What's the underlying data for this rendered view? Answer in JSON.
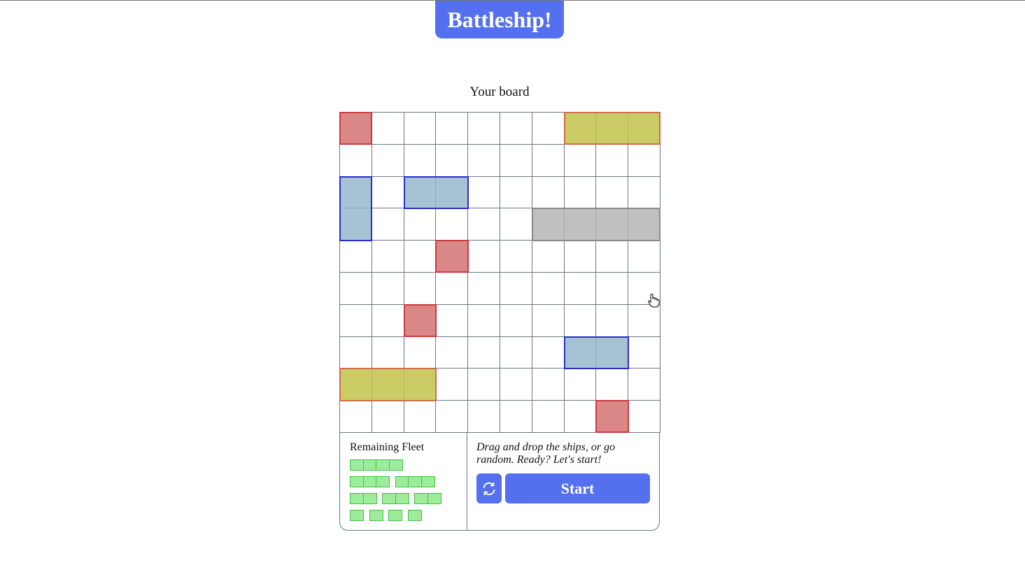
{
  "app": {
    "title": "Battleship!"
  },
  "board": {
    "label": "Your board",
    "rows": 10,
    "cols": 10,
    "ships": [
      {
        "color": "red",
        "row": 0,
        "col": 0,
        "length": 1,
        "orientation": "horizontal"
      },
      {
        "color": "yellow",
        "row": 0,
        "col": 7,
        "length": 3,
        "orientation": "horizontal"
      },
      {
        "color": "blue",
        "row": 2,
        "col": 0,
        "length": 2,
        "orientation": "vertical"
      },
      {
        "color": "blue",
        "row": 2,
        "col": 2,
        "length": 2,
        "orientation": "horizontal"
      },
      {
        "color": "gray",
        "row": 3,
        "col": 6,
        "length": 4,
        "orientation": "horizontal"
      },
      {
        "color": "red",
        "row": 4,
        "col": 3,
        "length": 1,
        "orientation": "horizontal"
      },
      {
        "color": "red",
        "row": 6,
        "col": 2,
        "length": 1,
        "orientation": "horizontal"
      },
      {
        "color": "blue",
        "row": 7,
        "col": 7,
        "length": 2,
        "orientation": "horizontal"
      },
      {
        "color": "yellow",
        "row": 8,
        "col": 0,
        "length": 3,
        "orientation": "horizontal"
      },
      {
        "color": "red",
        "row": 9,
        "col": 8,
        "length": 1,
        "orientation": "horizontal"
      }
    ]
  },
  "fleet": {
    "title": "Remaining Fleet",
    "rows": [
      [
        4
      ],
      [
        3,
        3
      ],
      [
        2,
        2,
        2
      ],
      [
        1,
        1,
        1,
        1
      ]
    ]
  },
  "actions": {
    "hint": "Drag and drop the ships, or go random. Ready? Let's start!",
    "randomize_icon": "refresh-icon",
    "start_label": "Start"
  },
  "colors": {
    "accent": "#5570ee",
    "grid": "#6b7785",
    "fleet_fill": "#9feb9c",
    "fleet_border": "#3dc442"
  }
}
